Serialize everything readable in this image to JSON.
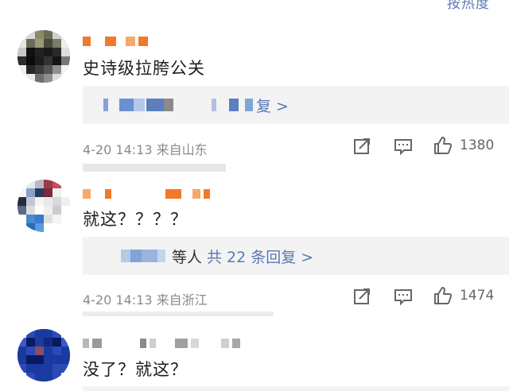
{
  "top_sort_label": "按热度",
  "comments": [
    {
      "text": "史诗级拉胯公关",
      "reply_link": "复 >",
      "meta": "4-20 14:13  来自山东",
      "likes": "1380"
    },
    {
      "text": "就这？？？？",
      "reply_prefix": "等人",
      "reply_link": "共 22 条回复 >",
      "meta": "4-20 14:13  来自浙江",
      "likes": "1474"
    },
    {
      "text": "没了？就这？"
    }
  ],
  "icons": [
    "share-icon",
    "comment-icon",
    "like-icon"
  ],
  "colors": {
    "link": "#5a78b5",
    "meta": "#8a8a8a",
    "reply_bg": "#f3f3f3",
    "username_orange": "#f07a2a"
  }
}
